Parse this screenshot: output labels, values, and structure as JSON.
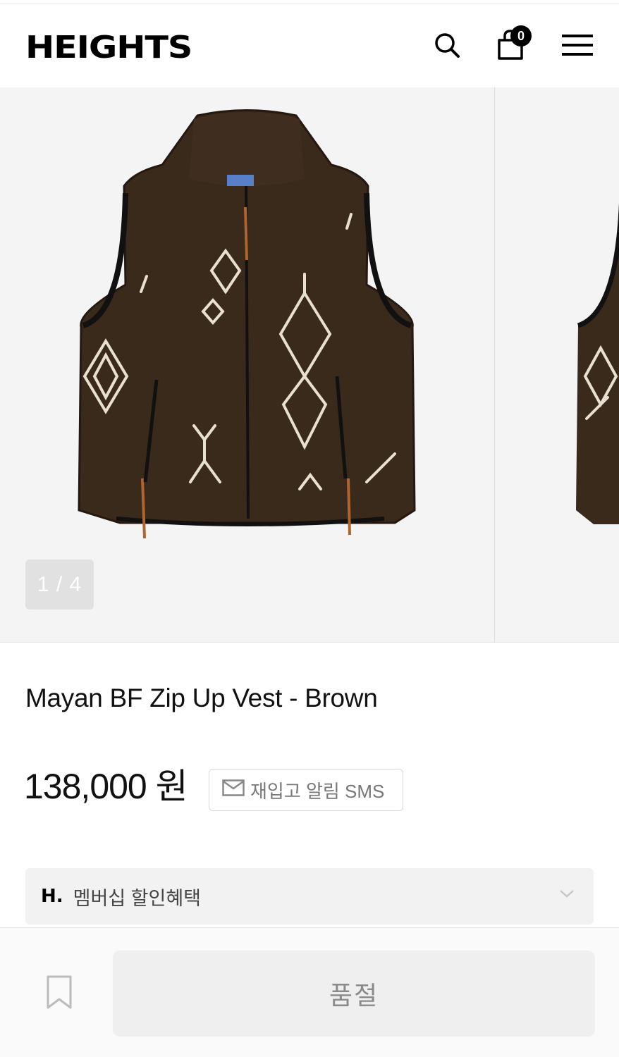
{
  "header": {
    "logo": "HEIGHTS",
    "cart_count": "0"
  },
  "gallery": {
    "counter": "1 / 4"
  },
  "product": {
    "name": "Mayan BF Zip Up Vest - Brown",
    "price": "138,000 원",
    "restock_label": "재입고 알림 SMS"
  },
  "membership": {
    "logo": "H.",
    "label": "멤버십 할인혜택"
  },
  "actions": {
    "soldout_label": "품절"
  },
  "colors": {
    "vest_brown": "#3a2a1c",
    "pattern_cream": "#e8e0d0",
    "accent_black": "#000000"
  }
}
